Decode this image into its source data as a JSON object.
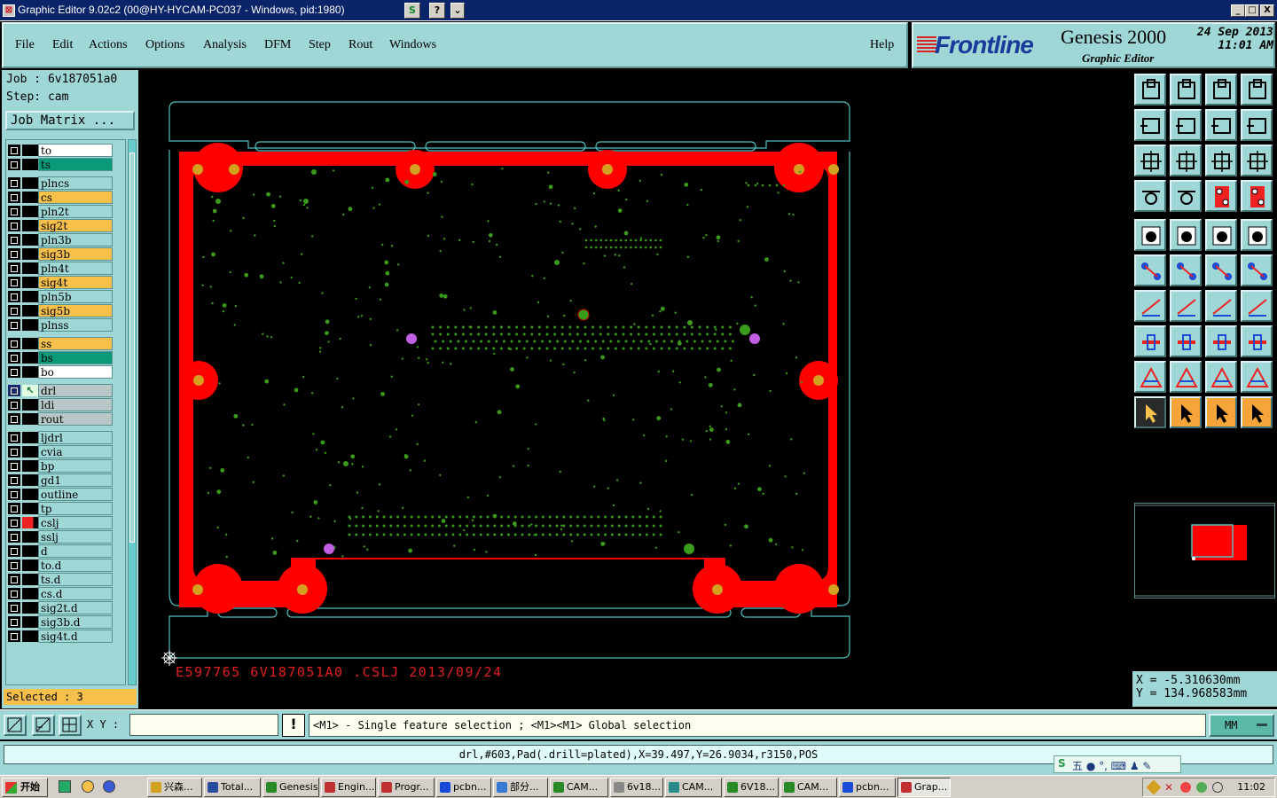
{
  "window": {
    "title": "Graphic Editor 9.02c2 (00@HY-HYCAM-PC037 - Windows, pid:1980)",
    "mini_buttons": [
      "S",
      "?",
      "⌄"
    ],
    "controls": [
      "_",
      "□",
      "X"
    ]
  },
  "menu": {
    "items": [
      "File",
      "Edit",
      "Actions",
      "Options",
      "Analysis",
      "DFM",
      "Step",
      "Rout",
      "Windows"
    ],
    "help": "Help"
  },
  "brand": {
    "logo": "Frontline",
    "product": "Genesis 2000",
    "subtitle": "Graphic Editor",
    "date": "24 Sep 2013",
    "time": "11:01 AM"
  },
  "job": {
    "job_line": "Job : 6v187051a0",
    "step_line": "Step: cam",
    "matrix_button": "Job Matrix ..."
  },
  "layers": [
    {
      "name": "to",
      "color": "#ffffff"
    },
    {
      "name": "ts",
      "color": "#0a9a7a"
    },
    {
      "name": "plncs",
      "color": "#9fd6d6"
    },
    {
      "name": "cs",
      "color": "#f6c04a"
    },
    {
      "name": "pln2t",
      "color": "#9fd6d6"
    },
    {
      "name": "sig2t",
      "color": "#f6c04a"
    },
    {
      "name": "pln3b",
      "color": "#9fd6d6"
    },
    {
      "name": "sig3b",
      "color": "#f6c04a"
    },
    {
      "name": "pln4t",
      "color": "#9fd6d6"
    },
    {
      "name": "sig4t",
      "color": "#f6c04a"
    },
    {
      "name": "pln5b",
      "color": "#9fd6d6"
    },
    {
      "name": "sig5b",
      "color": "#f6c04a"
    },
    {
      "name": "plnss",
      "color": "#9fd6d6"
    },
    {
      "name": "ss",
      "color": "#f6c04a"
    },
    {
      "name": "bs",
      "color": "#0a9a7a"
    },
    {
      "name": "bo",
      "color": "#ffffff"
    },
    {
      "name": "drl",
      "color": "#b8c8c8"
    },
    {
      "name": "ldi",
      "color": "#b8c8c8"
    },
    {
      "name": "rout",
      "color": "#b8c8c8"
    },
    {
      "name": "ljdrl",
      "color": "#9fd6d6"
    },
    {
      "name": "cvia",
      "color": "#9fd6d6"
    },
    {
      "name": "bp",
      "color": "#9fd6d6"
    },
    {
      "name": "gd1",
      "color": "#9fd6d6"
    },
    {
      "name": "outline",
      "color": "#9fd6d6"
    },
    {
      "name": "tp",
      "color": "#9fd6d6"
    },
    {
      "name": "cslj",
      "color": "#9fd6d6"
    },
    {
      "name": "sslj",
      "color": "#9fd6d6"
    },
    {
      "name": "d",
      "color": "#9fd6d6"
    },
    {
      "name": "to.d",
      "color": "#9fd6d6"
    },
    {
      "name": "ts.d",
      "color": "#9fd6d6"
    },
    {
      "name": "cs.d",
      "color": "#9fd6d6"
    },
    {
      "name": "sig2t.d",
      "color": "#9fd6d6"
    },
    {
      "name": "sig3b.d",
      "color": "#9fd6d6"
    },
    {
      "name": "sig4t.d",
      "color": "#9fd6d6"
    }
  ],
  "selected": "Selected : 3",
  "board": {
    "copper_color": "#ff0000",
    "pad_color": "#d4a020",
    "via_color": "#3a9a1a",
    "fiducial_color": "#c060e0",
    "outline_color": "#50c0c0",
    "silk_text": "E597765 6V187051A0 .CSLJ 2013/09/24"
  },
  "coords": {
    "x": "X = -5.310630mm",
    "y": "Y = 134.968583mm"
  },
  "input": {
    "xy_label": "X Y :",
    "xy_value": "",
    "prompt": "<M1> - Single feature selection ; <M1><M1> Global selection",
    "unit": "MM"
  },
  "status": "drl,#603,Pad(.drill=plated),X=39.497,Y=26.9034,r3150,POS",
  "ime": "五 ● °, ⌨ ♟ ✎",
  "taskbar": {
    "start": "开始",
    "tasks": [
      "兴森...",
      "Total...",
      "Genesis",
      "Engin...",
      "Progr...",
      "pcbn...",
      "部分...",
      "CAM...",
      "6v18...",
      "CAM...",
      "6V18...",
      "CAM...",
      "pcbn...",
      "Grap..."
    ],
    "clock": "11:02"
  }
}
